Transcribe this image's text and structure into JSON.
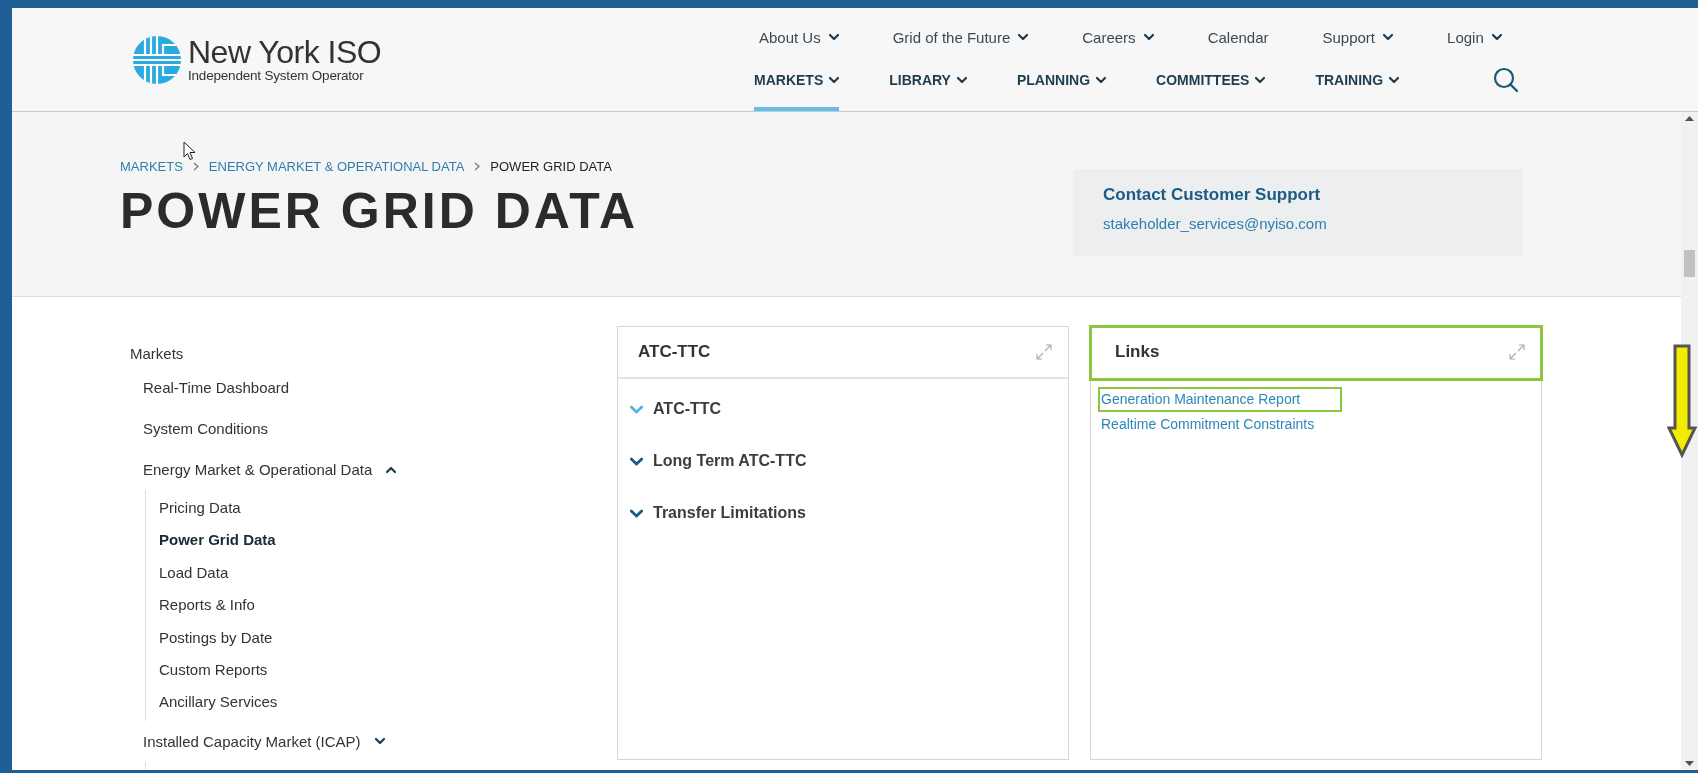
{
  "logo": {
    "name": "New York ISO",
    "tagline": "Independent System Operator"
  },
  "top_nav": [
    {
      "label": "About Us",
      "has_menu": true
    },
    {
      "label": "Grid of the Future",
      "has_menu": true
    },
    {
      "label": "Careers",
      "has_menu": true
    },
    {
      "label": "Calendar",
      "has_menu": false
    },
    {
      "label": "Support",
      "has_menu": true
    },
    {
      "label": "Login",
      "has_menu": true
    }
  ],
  "main_nav": [
    {
      "label": "MARKETS",
      "selected": true
    },
    {
      "label": "LIBRARY",
      "selected": false
    },
    {
      "label": "PLANNING",
      "selected": false
    },
    {
      "label": "COMMITTEES",
      "selected": false
    },
    {
      "label": "TRAINING",
      "selected": false
    }
  ],
  "breadcrumb": [
    {
      "label": "MARKETS",
      "current": false
    },
    {
      "label": "ENERGY MARKET & OPERATIONAL DATA",
      "current": false
    },
    {
      "label": "POWER GRID DATA",
      "current": true
    }
  ],
  "page_title": "POWER GRID DATA",
  "contact": {
    "title": "Contact Customer Support",
    "email": "stakeholder_services@nyiso.com"
  },
  "sidebar": {
    "title": "Markets",
    "items": [
      {
        "label": "Real-Time Dashboard",
        "kind": "link"
      },
      {
        "label": "System Conditions",
        "kind": "link"
      },
      {
        "label": "Energy Market & Operational Data",
        "kind": "group",
        "expanded": true,
        "children": [
          {
            "label": "Pricing Data",
            "selected": false
          },
          {
            "label": "Power Grid Data",
            "selected": true
          },
          {
            "label": "Load Data",
            "selected": false
          },
          {
            "label": "Reports & Info",
            "selected": false
          },
          {
            "label": "Postings by Date",
            "selected": false
          },
          {
            "label": "Custom Reports",
            "selected": false
          },
          {
            "label": "Ancillary Services",
            "selected": false
          }
        ]
      },
      {
        "label": "Installed Capacity Market (ICAP)",
        "kind": "group",
        "expanded": false
      }
    ]
  },
  "panels": [
    {
      "title": "ATC-TTC",
      "kind": "accordion",
      "highlighted": false,
      "items": [
        {
          "label": "ATC-TTC",
          "active": true
        },
        {
          "label": "Long Term ATC-TTC",
          "active": false
        },
        {
          "label": "Transfer Limitations",
          "active": false
        }
      ]
    },
    {
      "title": "Links",
      "kind": "links",
      "highlighted": true,
      "links": [
        {
          "label": "Generation Maintenance Report",
          "highlighted": true
        },
        {
          "label": "Realtime Commitment Constraints",
          "highlighted": false
        }
      ]
    }
  ],
  "annotation": {
    "kind": "down-arrow"
  }
}
